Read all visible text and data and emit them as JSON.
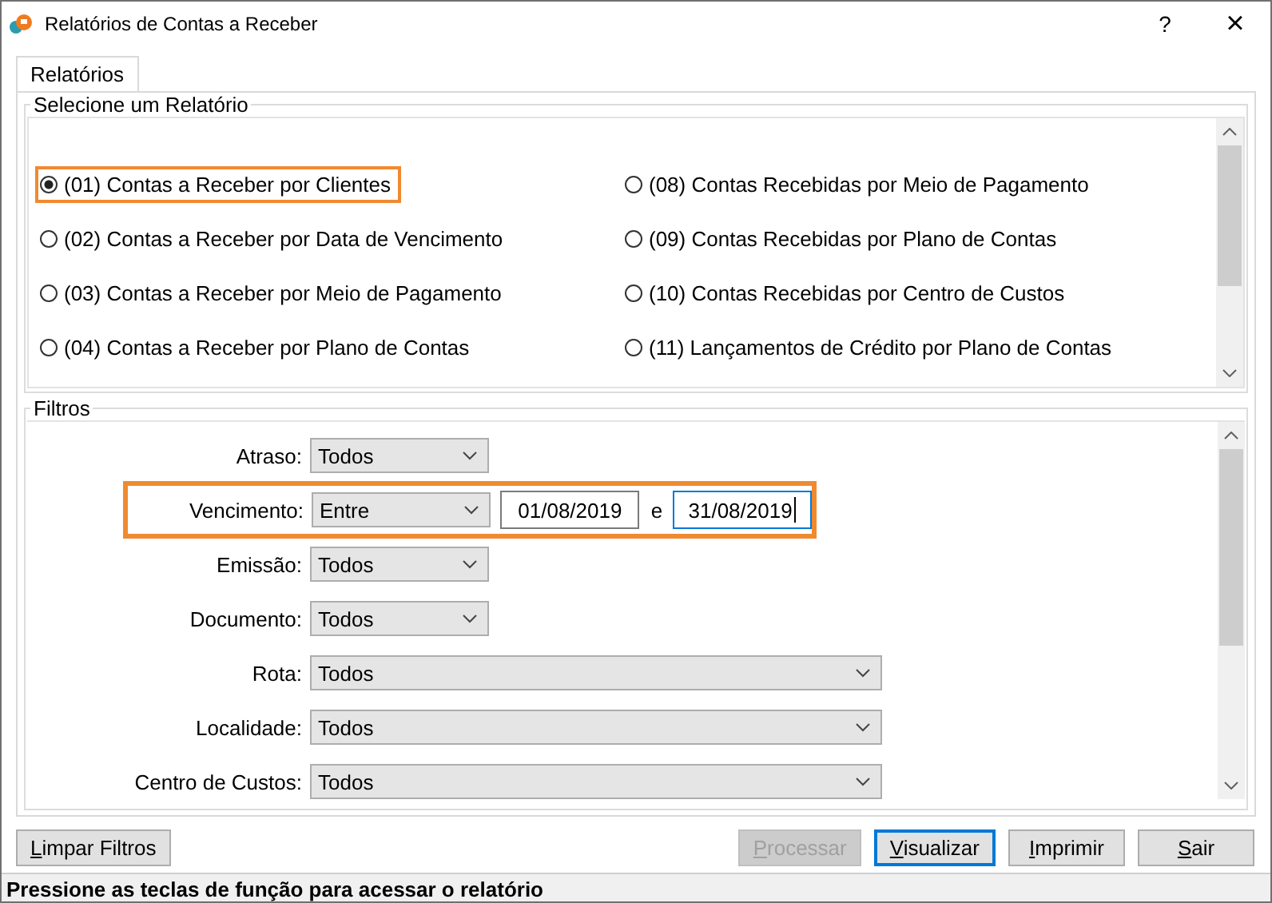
{
  "window": {
    "title": "Relatórios de Contas a Receber",
    "help": "?",
    "close": "×"
  },
  "tabs": [
    {
      "label": "Relatórios",
      "selected": true
    }
  ],
  "reports": {
    "title": "Selecione um Relatório",
    "items": [
      {
        "label": "(01) Contas a Receber por Clientes",
        "selected": true,
        "highlighted": true
      },
      {
        "label": "(08) Contas Recebidas por Meio de Pagamento",
        "selected": false,
        "highlighted": false
      },
      {
        "label": "(02) Contas a Receber por Data de Vencimento",
        "selected": false,
        "highlighted": false
      },
      {
        "label": "(09) Contas Recebidas por Plano de Contas",
        "selected": false,
        "highlighted": false
      },
      {
        "label": "(03) Contas a Receber por Meio de Pagamento",
        "selected": false,
        "highlighted": false
      },
      {
        "label": "(10) Contas Recebidas por Centro de Custos",
        "selected": false,
        "highlighted": false
      },
      {
        "label": "(04) Contas a Receber por Plano de Contas",
        "selected": false,
        "highlighted": false
      },
      {
        "label": "(11) Lançamentos de Crédito por Plano de Contas",
        "selected": false,
        "highlighted": false
      }
    ]
  },
  "filters": {
    "title": "Filtros",
    "rows": [
      {
        "kind": "short-select",
        "label": "Atraso:",
        "value": "Todos",
        "highlighted": false
      },
      {
        "kind": "date-range",
        "label": "Vencimento:",
        "value": "Entre",
        "from": "01/08/2019",
        "separator": "e",
        "to": "31/08/2019",
        "highlighted": true
      },
      {
        "kind": "short-select",
        "label": "Emissão:",
        "value": "Todos",
        "highlighted": false
      },
      {
        "kind": "short-select",
        "label": "Documento:",
        "value": "Todos",
        "highlighted": false
      },
      {
        "kind": "long-select",
        "label": "Rota:",
        "value": "Todos",
        "highlighted": false
      },
      {
        "kind": "long-select",
        "label": "Localidade:",
        "value": "Todos",
        "highlighted": false
      },
      {
        "kind": "long-select",
        "label": "Centro de Custos:",
        "value": "Todos",
        "highlighted": false
      }
    ]
  },
  "buttons": [
    {
      "label": "Limpar Filtros",
      "disabled": false,
      "default": false
    },
    {
      "label": "Processar",
      "disabled": true,
      "default": false
    },
    {
      "label": "Visualizar",
      "disabled": false,
      "default": true
    },
    {
      "label": "Imprimir",
      "disabled": false,
      "default": false
    },
    {
      "label": "Sair",
      "disabled": false,
      "default": false
    }
  ],
  "status_bar": "Pressione as teclas de função para acessar o relatório"
}
